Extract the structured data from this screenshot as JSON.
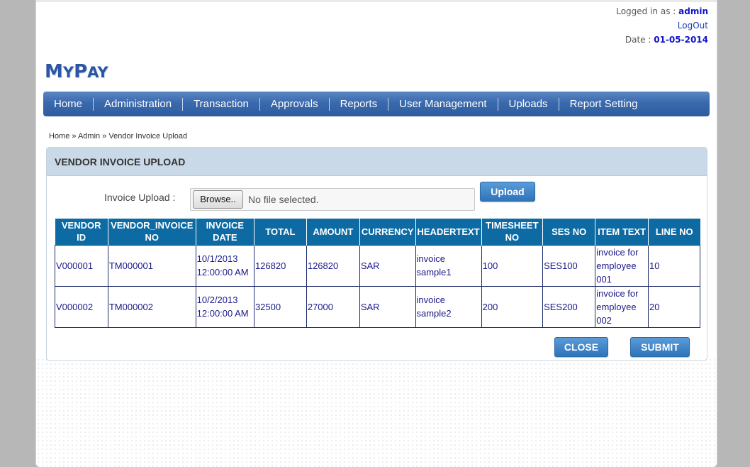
{
  "user": {
    "logged_in_label": "Logged in as : ",
    "username": "admin",
    "logout": "LogOut",
    "date_label": "Date : ",
    "date_value": "01-05-2014"
  },
  "logo": {
    "first": "M",
    "rest1": "Y",
    "first2": "P",
    "rest2": "AY"
  },
  "nav": [
    "Home",
    "Administration",
    "Transaction",
    "Approvals",
    "Reports",
    "User Management",
    "Uploads",
    "Report Setting"
  ],
  "breadcrumb": "Home » Admin » Vendor Invoice Upload",
  "panel": {
    "title": "VENDOR INVOICE UPLOAD",
    "upload_label": "Invoice Upload :",
    "browse_label": "Browse..",
    "file_status": "No file selected.",
    "upload_button": "Upload"
  },
  "table": {
    "headers": [
      [
        "VENDOR ID"
      ],
      [
        "VENDOR_INVOICE",
        "NO"
      ],
      [
        "INVOICE",
        "DATE"
      ],
      [
        "TOTAL"
      ],
      [
        "AMOUNT"
      ],
      [
        "CURRENCY"
      ],
      [
        "HEADERTEXT"
      ],
      [
        "TIMESHEET",
        "NO"
      ],
      [
        "SES NO"
      ],
      [
        "ITEM TEXT"
      ],
      [
        "LINE NO"
      ]
    ],
    "rows": [
      [
        [
          "V000001"
        ],
        [
          "TM000001"
        ],
        [
          "10/1/2013",
          "12:00:00 AM"
        ],
        [
          "126820"
        ],
        [
          "126820"
        ],
        [
          "SAR"
        ],
        [
          "invoice",
          "sample1"
        ],
        [
          "100"
        ],
        [
          "SES100"
        ],
        [
          "invoice for",
          "employee",
          "001"
        ],
        [
          "10"
        ]
      ],
      [
        [
          "V000002"
        ],
        [
          "TM000002"
        ],
        [
          "10/2/2013",
          "12:00:00 AM"
        ],
        [
          "32500"
        ],
        [
          "27000"
        ],
        [
          "SAR"
        ],
        [
          "invoice",
          "sample2"
        ],
        [
          "200"
        ],
        [
          "SES200"
        ],
        [
          "invoice for",
          "employee",
          "002"
        ],
        [
          "20"
        ]
      ]
    ]
  },
  "buttons": {
    "close": "CLOSE",
    "submit": "SUBMIT"
  }
}
